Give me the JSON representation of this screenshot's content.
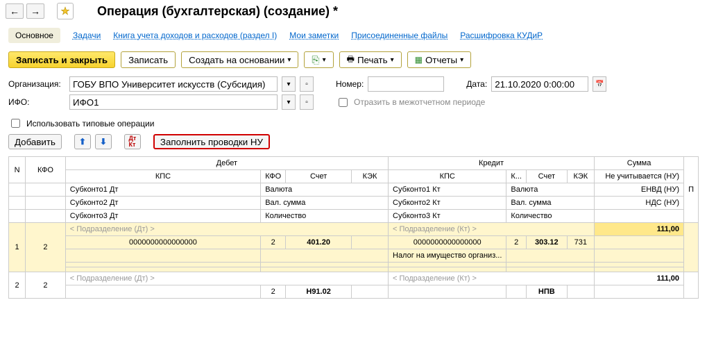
{
  "nav": {
    "back": "←",
    "fwd": "→"
  },
  "title": "Операция (бухгалтерская) (создание) *",
  "tabs": {
    "main": "Основное",
    "tasks": "Задачи",
    "book": "Книга учета доходов и расходов (раздел I)",
    "notes": "Мои заметки",
    "files": "Присоединенные файлы",
    "kudir": "Расшифровка КУДиР"
  },
  "toolbar": {
    "save_close": "Записать и закрыть",
    "save": "Записать",
    "create_based": "Создать на основании",
    "print": "Печать",
    "reports": "Отчеты"
  },
  "form": {
    "org_label": "Организация:",
    "org_value": "ГОБУ ВПО Университет искусств (Субсидия)",
    "num_label": "Номер:",
    "num_value": "",
    "date_label": "Дата:",
    "date_value": "21.10.2020 0:00:00",
    "ifo_label": "ИФО:",
    "ifo_value": "ИФО1",
    "reflect_label": "Отразить в межотчетном периоде",
    "use_typical_label": "Использовать типовые операции"
  },
  "row2": {
    "add": "Добавить",
    "fill_nu": "Заполнить проводки НУ"
  },
  "grid": {
    "n": "N",
    "kfo": "КФО",
    "debit": "Дебет",
    "credit": "Кредит",
    "sum": "Сумма",
    "p": "П",
    "kps": "КПС",
    "sch": "Счет",
    "kek": "КЭК",
    "k": "К...",
    "not_counted": "Не учитывается (НУ)",
    "sub1dt": "Субконто1 Дт",
    "sub2dt": "Субконто2 Дт",
    "sub3dt": "Субконто3 Дт",
    "valuta": "Валюта",
    "valsum": "Вал. сумма",
    "kolvo": "Количество",
    "sub1kt": "Субконто1 Кт",
    "sub2kt": "Субконто2 Кт",
    "sub3kt": "Субконто3 Кт",
    "envd": "ЕНВД (НУ)",
    "nds": "НДС (НУ)"
  },
  "rows": [
    {
      "n": "1",
      "kfo": "2",
      "podr_dt": "< Подразделение (Дт) >",
      "kps_dt": "0000000000000000",
      "kfo2_dt": "2",
      "sch_dt": "401.20",
      "kek_dt": "",
      "podr_kt": "< Подразделение (Кт) >",
      "kps_kt": "0000000000000000",
      "kfo2_kt": "2",
      "sch_kt": "303.12",
      "kek_kt": "731",
      "tax_line": "Налог на имущество организ...",
      "sum": "111,00"
    },
    {
      "n": "2",
      "kfo": "2",
      "podr_dt": "< Подразделение (Дт) >",
      "kfo2_dt": "2",
      "sch_dt": "Н91.02",
      "podr_kt": "< Подразделение (Кт) >",
      "sch_kt": "НПВ",
      "sum": "111,00"
    }
  ]
}
